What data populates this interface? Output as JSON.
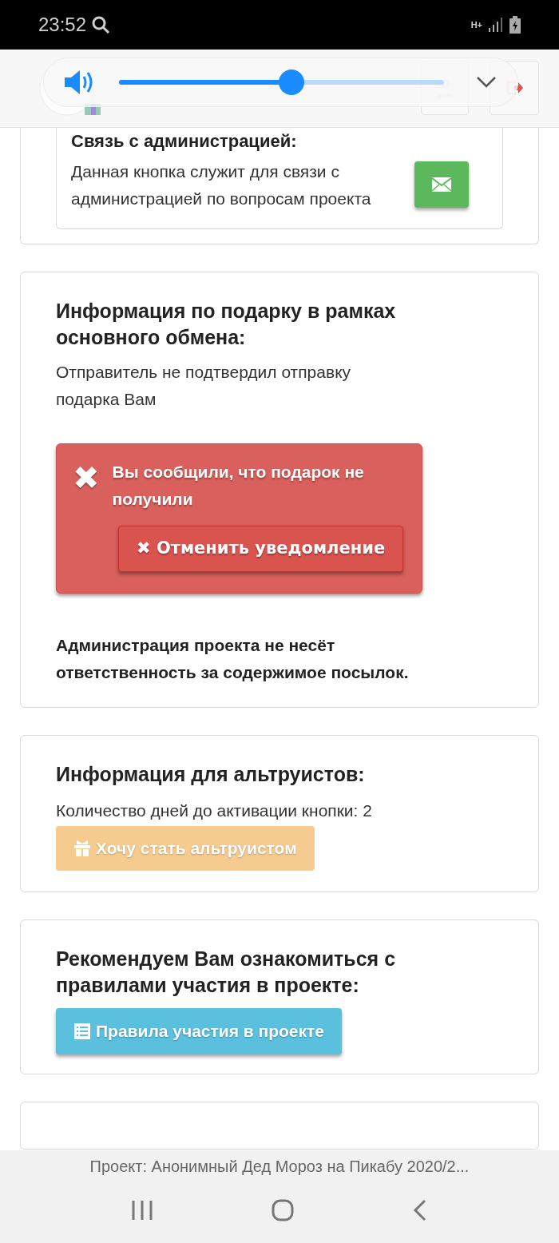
{
  "status_bar": {
    "time": "23:52",
    "network": "H+"
  },
  "volume": {
    "level": 0.53
  },
  "contact_card": {
    "title": "Связь с администрацией:",
    "text": "Данная кнопка служит для связи с администрацией по вопросам проекта"
  },
  "gift_card": {
    "title": "Информация по подарку в рамках основного обмена:",
    "status": "Отправитель не подтвердил отправку подарка Вам",
    "alert": {
      "icon": "✖",
      "text": "Вы сообщили, что подарок не получили",
      "button": "✖ Отменить уведомление"
    },
    "disclaimer": "Администрация проекта не несёт ответственность за содержимое посылок."
  },
  "altruist_card": {
    "title": "Информация для альтруистов:",
    "text": "Количество дней до активации кнопки: 2",
    "button": {
      "label": "Хочу стать альтруистом",
      "disabled": true
    }
  },
  "rules_card": {
    "title": "Рекомендуем Вам ознакомиться с правилами участия в проекте:",
    "button": "Правила участия в проекте"
  },
  "footer": {
    "page_title": "Проект: Анонимный Дед Мороз на Пикабу 2020/2..."
  }
}
